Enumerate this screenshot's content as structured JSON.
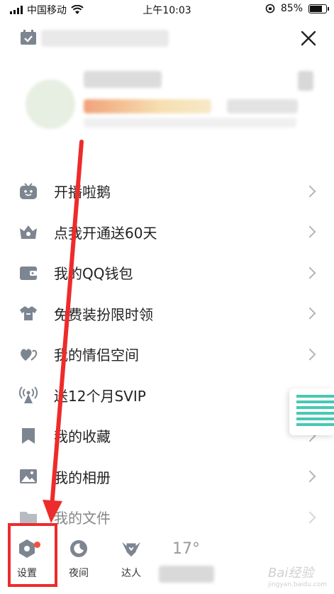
{
  "status_bar": {
    "carrier": "中国移动",
    "time": "上午10:03",
    "battery_percent": "85%",
    "battery_level": 0.85
  },
  "menu": {
    "items": [
      {
        "label": "开播啦鹅",
        "icon": "tv-icon"
      },
      {
        "label": "点我开通送60天",
        "icon": "crown-icon"
      },
      {
        "label": "我的QQ钱包",
        "icon": "wallet-icon"
      },
      {
        "label": "免费装扮限时领",
        "icon": "shirt-icon"
      },
      {
        "label": "我的情侣空间",
        "icon": "hearts-icon"
      },
      {
        "label": "送12个月SVIP",
        "icon": "broadcast-icon"
      },
      {
        "label": "我的收藏",
        "icon": "bookmark-icon"
      },
      {
        "label": "我的相册",
        "icon": "photo-icon"
      },
      {
        "label": "我的文件",
        "icon": "folder-icon"
      }
    ]
  },
  "bottom_bar": {
    "settings_label": "设置",
    "night_label": "夜间",
    "expert_label": "达人",
    "temperature": "17°"
  },
  "watermark": {
    "brand": "Bai经验",
    "url": "jingyan.baidu.com"
  },
  "colors": {
    "icon_gray": "#7d8591",
    "accent_red": "#ee2b2b",
    "badge": "#f5523d",
    "widget_teal": "#47c9b3"
  }
}
